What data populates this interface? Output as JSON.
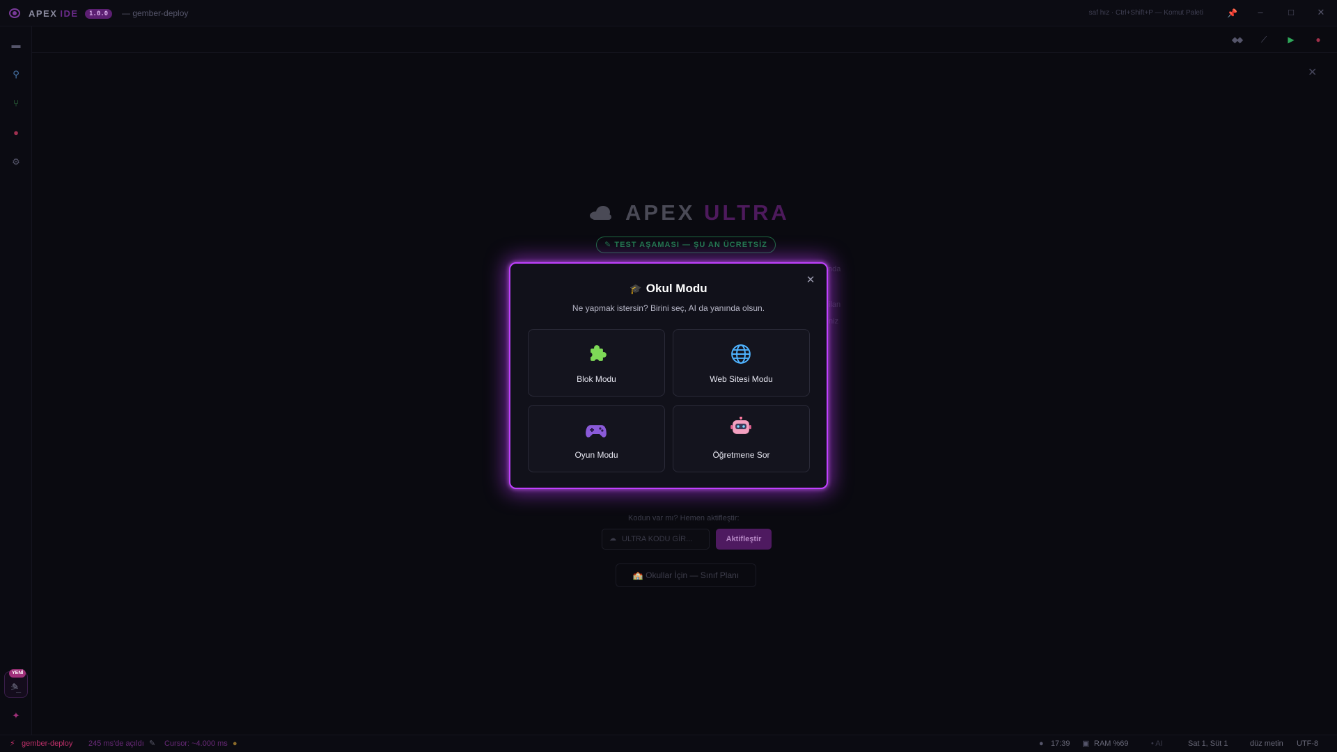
{
  "titlebar": {
    "brand": "APEX",
    "brand_suffix": "IDE",
    "version": "1.0.0",
    "project": "— gember-deploy",
    "command_hint": "saf hız · Ctrl+Shift+P — Komut Paleti",
    "minimize": "–",
    "maximize": "□",
    "close": "✕"
  },
  "hero": {
    "title_a": "APEX",
    "title_b": "ULTRA",
    "badge": "✎ TEST AŞAMASI — ŞU AN ÜCRETSİZ",
    "ghost_1": "ında",
    "ghost_2": "ilan",
    "ghost_3": "niz"
  },
  "activation": {
    "label": "Kodun var mı? Hemen aktifleştir:",
    "placeholder": "ULTRA KODU GİR...",
    "button": "Aktifleştir",
    "school_plan": "🏫 Okullar İçin — Sınıf Planı"
  },
  "new_badge": "YENİ",
  "modal": {
    "title": "Okul Modu",
    "subtitle": "Ne yapmak istersin? Birini seç, AI da yanında olsun.",
    "cards": [
      {
        "label": "Blok Modu",
        "icon": "puzzle-icon"
      },
      {
        "label": "Web Sitesi Modu",
        "icon": "globe-icon"
      },
      {
        "label": "Oyun Modu",
        "icon": "gamepad-icon"
      },
      {
        "label": "Öğretmene Sor",
        "icon": "robot-icon"
      }
    ]
  },
  "statusbar": {
    "project": "gember-deploy",
    "opened": "245 ms'de açıldı",
    "cursor": "Cursor: ~4.000 ms",
    "time": "17:39",
    "ram": "RAM %69",
    "ai": "• AI",
    "position": "Sat 1, Süt 1",
    "language": "düz metin",
    "encoding": "UTF-8"
  },
  "colors": {
    "accent": "#c040ff",
    "brand_purple": "#5c1f72",
    "success_green": "#1e7a4a",
    "status_pink": "#c0306a"
  }
}
